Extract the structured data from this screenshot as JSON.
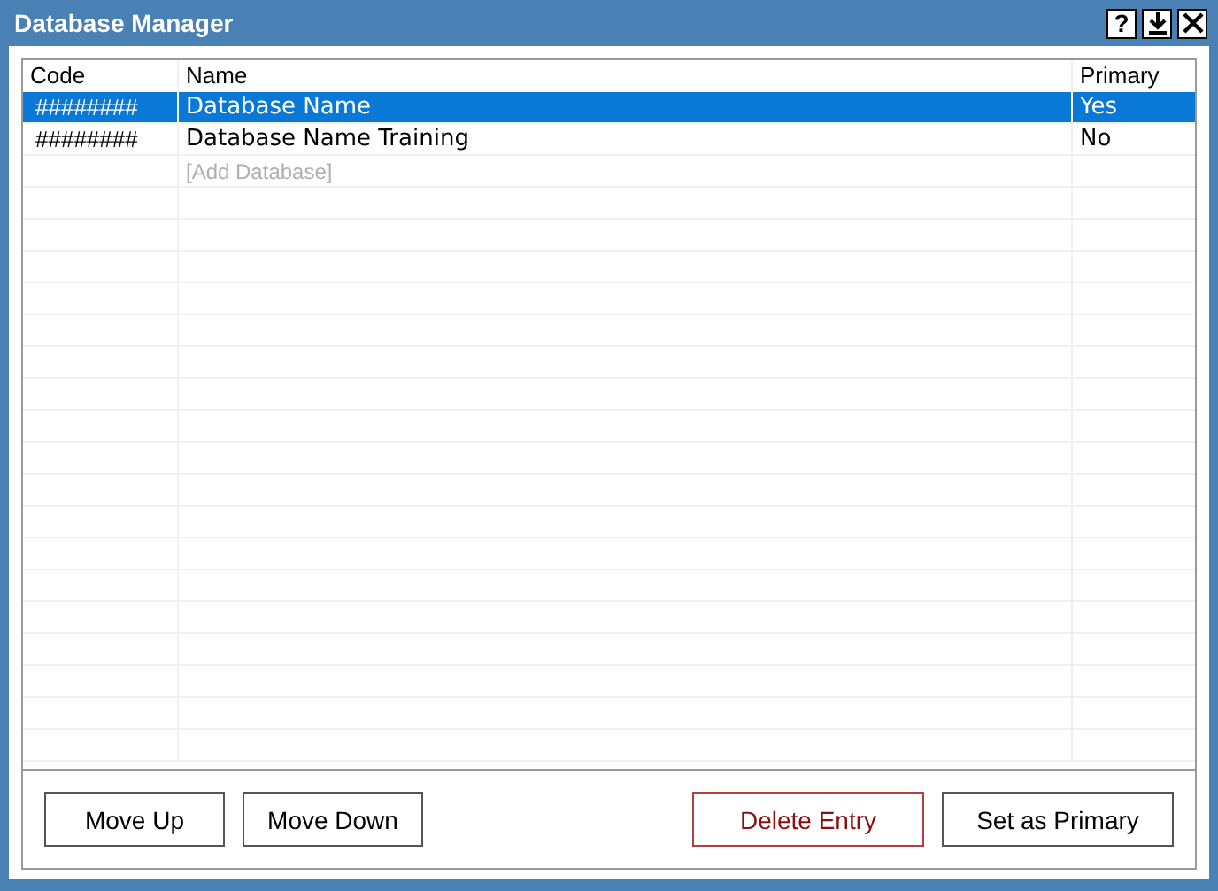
{
  "window": {
    "title": "Database Manager",
    "help_button": "?"
  },
  "table": {
    "columns": [
      "Code",
      "Name",
      "Primary"
    ],
    "rows": [
      {
        "code": "########",
        "name": "Database Name",
        "primary": "Yes",
        "selected": true
      },
      {
        "code": "########",
        "name": "Database Name Training",
        "primary": "No",
        "selected": false
      }
    ],
    "add_row": {
      "placeholder": "[Add Database]"
    }
  },
  "buttons": [
    {
      "label": "Move Up",
      "kind": "normal"
    },
    {
      "label": "Move Down",
      "kind": "normal"
    },
    {
      "label": "Delete Entry",
      "kind": "danger"
    },
    {
      "label": "Set as Primary",
      "kind": "normal"
    }
  ]
}
